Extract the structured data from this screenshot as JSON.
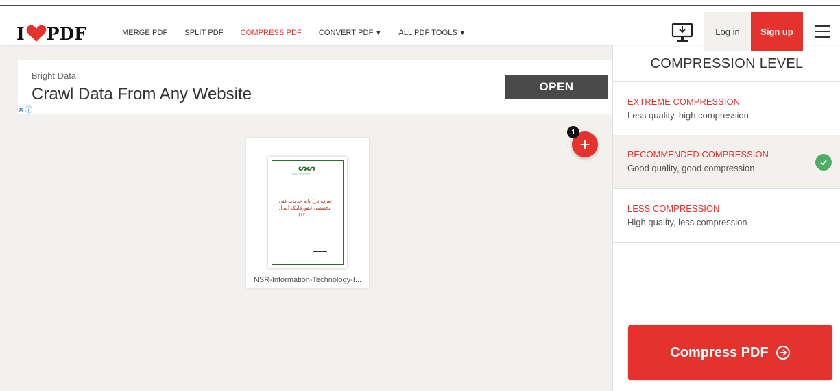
{
  "app": {
    "logo_prefix": "I",
    "logo_suffix": "PDF"
  },
  "nav": {
    "items": [
      {
        "label": "MERGE PDF"
      },
      {
        "label": "SPLIT PDF"
      },
      {
        "label": "COMPRESS PDF"
      },
      {
        "label": "CONVERT PDF"
      },
      {
        "label": "ALL PDF TOOLS"
      }
    ]
  },
  "header": {
    "login_label": "Log in",
    "signup_label": "Sign up",
    "desktop_icon": "desktop-download-icon",
    "menu_icon": "hamburger-menu-icon"
  },
  "ad": {
    "brand": "Bright Data",
    "headline": "Crawl Data From Any Website",
    "cta": "OPEN"
  },
  "workspace": {
    "add_badge_count": "1",
    "add_icon": "plus-icon",
    "files": [
      {
        "name": "NSR-Information-Technology-I...",
        "thumb_title": "تعرفه نرخ پایه خدمات فنی- تخصصی انفورماتیک (سال ۱۴۰۰)"
      }
    ]
  },
  "sidebar": {
    "title": "COMPRESSION LEVEL",
    "options": [
      {
        "title": "EXTREME COMPRESSION",
        "desc": "Less quality, high compression"
      },
      {
        "title": "RECOMMENDED COMPRESSION",
        "desc": "Good quality, good compression"
      },
      {
        "title": "LESS COMPRESSION",
        "desc": "High quality, less compression"
      }
    ],
    "action_label": "Compress PDF"
  },
  "colors": {
    "brand_red": "#e5322d",
    "check_green": "#4caf64",
    "background": "#f3f1ee"
  }
}
